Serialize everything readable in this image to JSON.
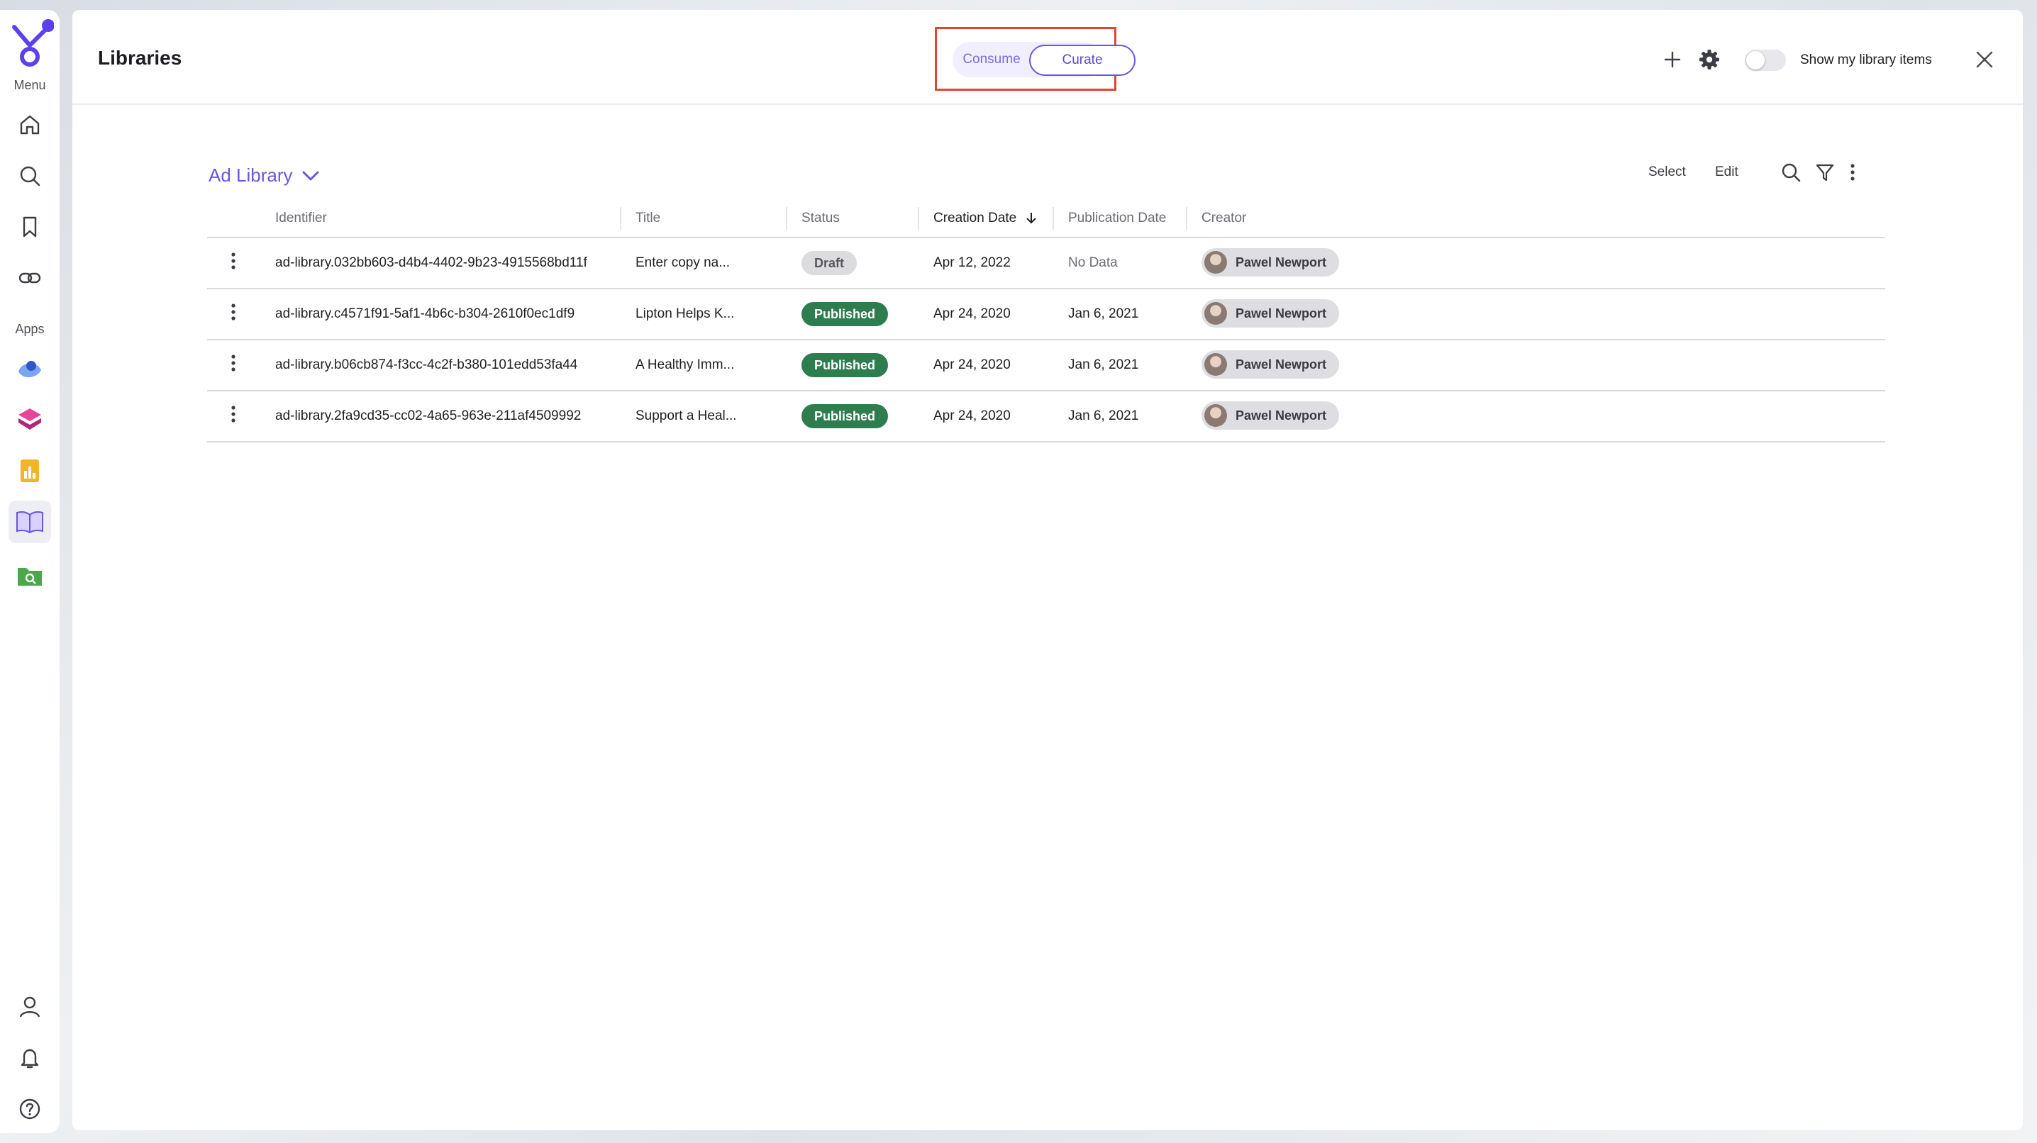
{
  "rail": {
    "menu_label": "Menu",
    "apps_label": "Apps",
    "menu_icons": [
      "home-icon",
      "search-icon",
      "bookmark-icon",
      "link-icon"
    ],
    "app_icons": [
      "app-blue-swirl-icon",
      "app-pink-cube-icon",
      "app-bar-chart-icon",
      "app-library-book-icon",
      "app-folder-search-icon"
    ],
    "bottom_icons": [
      "user-icon",
      "bell-icon",
      "help-icon"
    ],
    "accent": "#5b3ff0"
  },
  "header": {
    "title": "Libraries",
    "mode": {
      "consume_label": "Consume",
      "curate_label": "Curate",
      "selected": "Curate"
    },
    "show_my_items_label": "Show my library items",
    "show_my_items_on": false
  },
  "library": {
    "name": "Ad Library",
    "toolbar": {
      "select_label": "Select",
      "edit_label": "Edit"
    },
    "columns": {
      "identifier": "Identifier",
      "title": "Title",
      "status": "Status",
      "creation_date": "Creation Date",
      "publication_date": "Publication Date",
      "creator": "Creator"
    },
    "sort": {
      "column": "Creation Date",
      "direction": "descending"
    },
    "rows": [
      {
        "identifier": "ad-library.032bb603-d4b4-4402-9b23-4915568bd11f",
        "title": "Enter copy na...",
        "status": "Draft",
        "creation_date": "Apr 12, 2022",
        "publication_date": "No Data",
        "creator": "Pawel Newport"
      },
      {
        "identifier": "ad-library.c4571f91-5af1-4b6c-b304-2610f0ec1df9",
        "title": "Lipton Helps K...",
        "status": "Published",
        "creation_date": "Apr 24, 2020",
        "publication_date": "Jan 6, 2021",
        "creator": "Pawel Newport"
      },
      {
        "identifier": "ad-library.b06cb874-f3cc-4c2f-b380-101edd53fa44",
        "title": "A Healthy Imm...",
        "status": "Published",
        "creation_date": "Apr 24, 2020",
        "publication_date": "Jan 6, 2021",
        "creator": "Pawel Newport"
      },
      {
        "identifier": "ad-library.2fa9cd35-cc02-4a65-963e-211af4509992",
        "title": "Support a Heal...",
        "status": "Published",
        "creation_date": "Apr 24, 2020",
        "publication_date": "Jan 6, 2021",
        "creator": "Pawel Newport"
      }
    ],
    "status_colors": {
      "Draft": "#dcdcdf",
      "Published": "#2e7d4f"
    }
  }
}
